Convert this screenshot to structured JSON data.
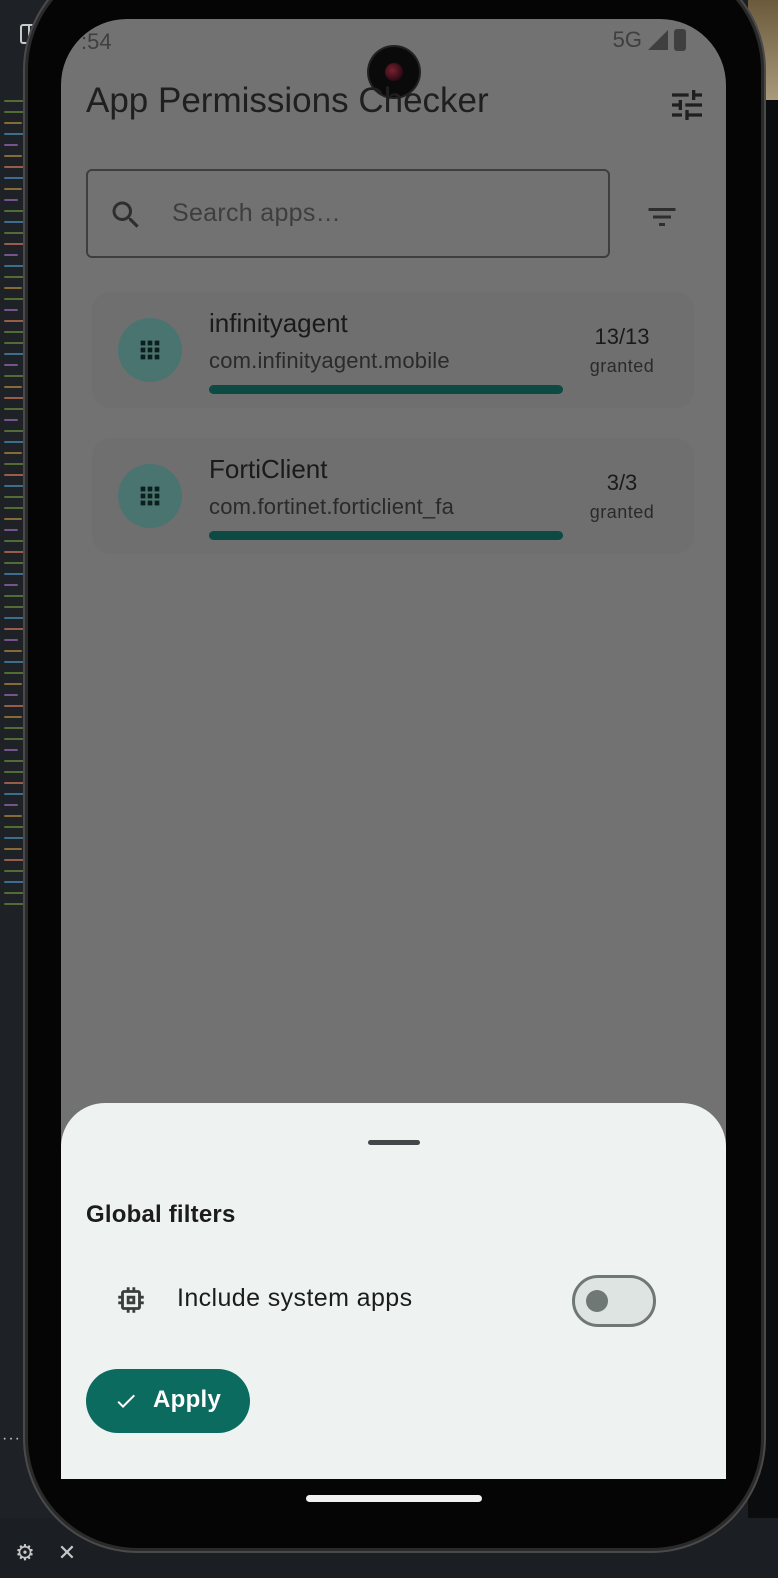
{
  "app": {
    "title": "App Permissions Checker"
  },
  "status_bar": {
    "time": ":54",
    "network": "5G"
  },
  "search": {
    "placeholder": "Search apps…"
  },
  "apps": [
    {
      "name": "infinityagent",
      "package": "com.infinityagent.mobile",
      "count": "13/13",
      "status": "granted",
      "granted_fraction": 1.0
    },
    {
      "name": "FortiClient",
      "package": "com.fortinet.forticlient_fa",
      "count": "3/3",
      "status": "granted",
      "granted_fraction": 1.0
    }
  ],
  "sheet": {
    "title": "Global filters",
    "toggle_label": "Include system apps",
    "toggle_on": false,
    "apply_label": "Apply"
  },
  "colors": {
    "accent": "#0b6b5f",
    "scrim": "#727272",
    "sheet_bg": "#eef3f1",
    "progress_fill": "#0e4a44"
  },
  "icons": {
    "tune": "tune-icon",
    "search": "search-icon",
    "filter": "filter-icon",
    "app": "grid-icon",
    "system": "chip-icon",
    "check": "check-icon"
  }
}
